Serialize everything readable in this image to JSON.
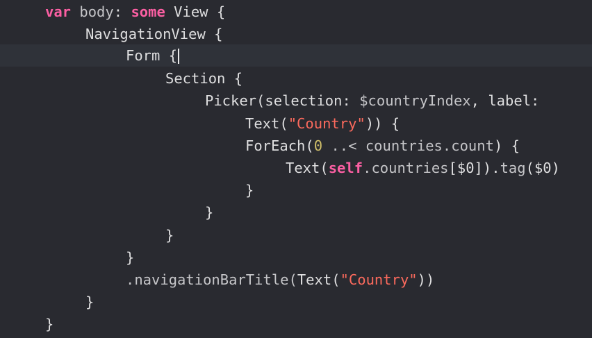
{
  "editor": {
    "language": "swift",
    "cursor_line": 3,
    "colors": {
      "background": "#292a30",
      "current_line": "#2f3239",
      "keyword": "#fc5fa3",
      "string": "#fc6a5d",
      "number": "#d0bf69",
      "plain": "#dfdfe0"
    },
    "lines": [
      {
        "tokens": [
          "var",
          "body",
          ":",
          "some",
          "View",
          "{"
        ]
      },
      {
        "tokens": [
          "NavigationView",
          "{"
        ]
      },
      {
        "tokens": [
          "Form",
          "{"
        ]
      },
      {
        "tokens": [
          "Section",
          "{"
        ]
      },
      {
        "tokens": [
          "Picker(",
          "selection",
          ":",
          "$countryIndex",
          ",",
          "label",
          ":"
        ]
      },
      {
        "tokens": [
          "Text(",
          "\"Country\"",
          ")) {"
        ]
      },
      {
        "tokens": [
          "ForEach(",
          "0",
          "..<",
          "countries",
          ".",
          "count",
          ") {"
        ]
      },
      {
        "tokens": [
          "Text(",
          "self",
          ".",
          "countries",
          "[$0]).",
          "tag",
          "($0)"
        ]
      },
      {
        "tokens": [
          "}"
        ]
      },
      {
        "tokens": [
          "}"
        ]
      },
      {
        "tokens": [
          "}"
        ]
      },
      {
        "tokens": [
          "}"
        ]
      },
      {
        "tokens": [
          ".navigationBarTitle(",
          "Text(",
          "\"Country\"",
          "))"
        ]
      },
      {
        "tokens": [
          "}"
        ]
      },
      {
        "tokens": [
          "}"
        ]
      }
    ]
  }
}
